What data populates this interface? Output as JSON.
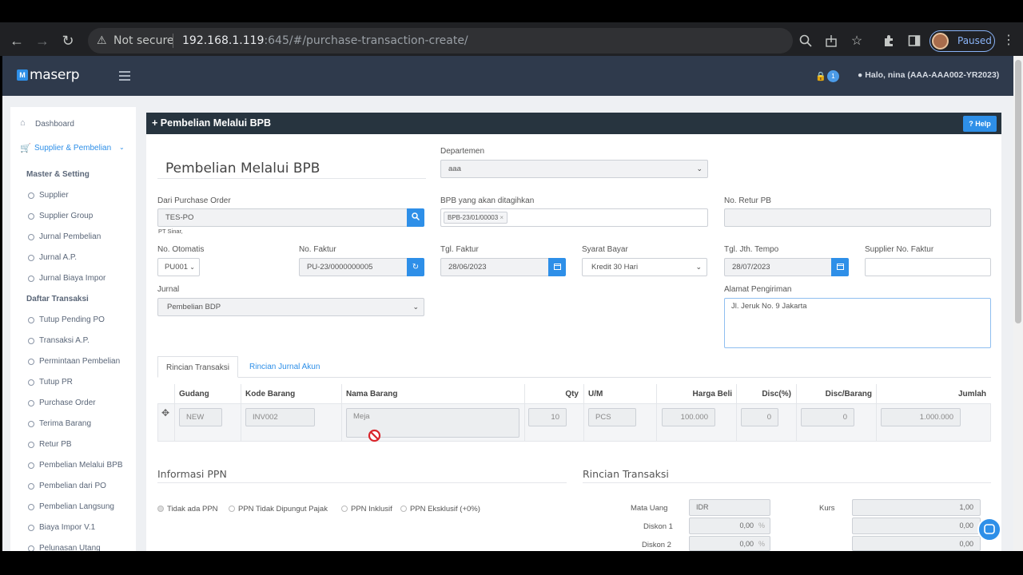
{
  "browser": {
    "not_secure": "Not secure",
    "url_host": "192.168.1.119",
    "url_rest": ":645/#/purchase-transaction-create/",
    "paused": "Paused"
  },
  "app": {
    "logo_mark": "M",
    "logo_text": "maserp",
    "notif_count": "1",
    "user": "Halo, nina (AAA-AAA002-YR2023)"
  },
  "sidebar": {
    "dashboard": "Dashboard",
    "module": "Supplier & Pembelian",
    "master_head": "Master & Setting",
    "master_items": [
      "Supplier",
      "Supplier Group",
      "Jurnal Pembelian",
      "Jurnal A.P.",
      "Jurnal Biaya Impor"
    ],
    "trans_head": "Daftar Transaksi",
    "trans_items": [
      "Tutup Pending PO",
      "Transaksi A.P.",
      "Permintaan Pembelian",
      "Tutup PR",
      "Purchase Order",
      "Terima Barang",
      "Retur PB",
      "Pembelian Melalui BPB",
      "Pembelian dari PO",
      "Pembelian Langsung",
      "Biaya Impor V.1",
      "Pelunasan Utang"
    ]
  },
  "card": {
    "header": "Pembelian Melalui BPB",
    "help": "Help",
    "big_title": "Pembelian Melalui BPB"
  },
  "form": {
    "departemen_label": "Departemen",
    "departemen_value": "aaa",
    "po_label": "Dari Purchase Order",
    "po_value": "TES-PO",
    "po_note": "PT Sinar,",
    "bpb_label": "BPB yang akan ditagihkan",
    "bpb_tag": "BPB-23/01/00003",
    "retur_label": "No. Retur PB",
    "otomatis_label": "No. Otomatis",
    "otomatis_value": "PU001",
    "faktur_label": "No. Faktur",
    "faktur_value": "PU-23/0000000005",
    "tgl_faktur_label": "Tgl. Faktur",
    "tgl_faktur_value": "28/06/2023",
    "syarat_label": "Syarat Bayar",
    "syarat_value": "Kredit 30 Hari",
    "tempo_label": "Tgl. Jth. Tempo",
    "tempo_value": "28/07/2023",
    "supplier_faktur_label": "Supplier No. Faktur",
    "jurnal_label": "Jurnal",
    "jurnal_value": "Pembelian BDP",
    "alamat_label": "Alamat Pengiriman",
    "alamat_value": "Jl. Jeruk No. 9 Jakarta"
  },
  "tabs": [
    "Rincian Transaksi",
    "Rincian Jurnal Akun"
  ],
  "table": {
    "headers": [
      "Gudang",
      "Kode Barang",
      "Nama Barang",
      "Qty",
      "U/M",
      "Harga Beli",
      "Disc(%)",
      "Disc/Barang",
      "Jumlah"
    ],
    "row": {
      "gudang": "NEW",
      "kode": "INV002",
      "nama": "Meja",
      "qty": "10",
      "um": "PCS",
      "harga": "100.000",
      "disc_pct": "0",
      "disc_barang": "0",
      "jumlah": "1.000.000"
    }
  },
  "ppn": {
    "title": "Informasi PPN",
    "options": [
      "Tidak ada PPN",
      "PPN Tidak Dipungut Pajak",
      "PPN Inklusif",
      "PPN Eksklusif (+0%)"
    ]
  },
  "rincian": {
    "title": "Rincian Transaksi",
    "mata_uang_label": "Mata Uang",
    "mata_uang": "IDR",
    "kurs_label": "Kurs",
    "kurs": "1,00",
    "diskon1_label": "Diskon 1",
    "diskon1": "0,00",
    "diskon1_right": "0,00",
    "diskon2_label": "Diskon 2",
    "diskon2": "0,00",
    "diskon2_right": "0,00",
    "pct": "%"
  }
}
